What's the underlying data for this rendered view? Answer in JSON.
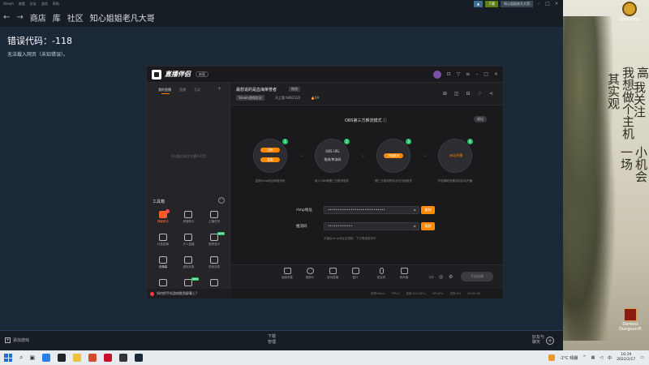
{
  "steam": {
    "titlebar_items": [
      "Steam",
      "查看",
      "好友",
      "游戏",
      "帮助"
    ],
    "top_btn": "",
    "green_btn": "下载",
    "user": "知心姐姐老凡大哥",
    "nav": [
      "商店",
      "库",
      "社区",
      "知心姐姐老凡大哥"
    ],
    "error_code": "错误代码：-118",
    "error_msg": "无法载入网页（未知错误）。",
    "add_game": "添加游戏",
    "downloads_title": "下载",
    "downloads_sub": "管理",
    "friends_l1": "好友与",
    "friends_l2": "聊天"
  },
  "desktop": {
    "icon1": "Cemonkyo",
    "icon2": "Darkest Dungeon®",
    "poem_cols": [
      "高",
      "我想做个主机",
      "其实观",
      "我关注",
      "一场",
      "小机会"
    ]
  },
  "app": {
    "name": "直播伴侣",
    "version": "新版",
    "left_tabs": [
      "我的直播",
      "直播",
      "互动"
    ],
    "empty_text": "0扫描后关注主播不可用",
    "tools_title": "工具箱",
    "tools": [
      {
        "label": "弹幕助手",
        "style": "red",
        "badge": "dot"
      },
      {
        "label": "房管助手",
        "style": "",
        "badge": ""
      },
      {
        "label": "主播任务",
        "style": "",
        "badge": ""
      },
      {
        "label": "抖音直播",
        "style": "",
        "badge": ""
      },
      {
        "label": "开人直播",
        "style": "",
        "badge": ""
      },
      {
        "label": "推荐音乐",
        "style": "",
        "badge": "new"
      },
      {
        "label": "设弹幕",
        "style": "bright",
        "badge": ""
      },
      {
        "label": "虚拟形象",
        "style": "",
        "badge": ""
      },
      {
        "label": "语音连麦",
        "style": "",
        "badge": ""
      },
      {
        "label": "",
        "style": "",
        "badge": ""
      },
      {
        "label": "",
        "style": "",
        "badge": "new"
      },
      {
        "label": "",
        "style": "",
        "badge": ""
      }
    ],
    "bottom_tip": "如何把手机游戏推到屏幕上?",
    "room_title": "最想说的是血海荣誉者",
    "room_edit": "修改",
    "room_tag": "Steam游戏实况",
    "room_id": "凡之我  9462120",
    "room_fire": "69",
    "mode_title": "OBS第三方推流模式",
    "exit": "退出",
    "steps": [
      {
        "num": "1",
        "pill1": "扫码",
        "pill2": "复制",
        "desc": "复制rtmp地址和推流码"
      },
      {
        "num": "2",
        "t1": "OBS URL",
        "t2": "推流/串流码",
        "desc": "填入OBS等第三方推流软件"
      },
      {
        "num": "3",
        "t1": "开始推流",
        "desc": "第三方推流软件点击开始推流"
      },
      {
        "num": "4",
        "t1": "启动开播",
        "desc": "伴侣确收到推流后启动开播"
      }
    ],
    "rtmp_label": "rtmp地址",
    "rtmp_value": "••••••••••••••••••••••••••••••",
    "key_label": "推流码",
    "key_value": "•••••••••••••",
    "copy": "复制",
    "field_tip": "关播后rtmp地址会更新，下次需重新填写",
    "toolbar": [
      "画面采集",
      "摄像头",
      "游戏直播",
      "窗口",
      "麦克风",
      "扬声器"
    ],
    "start_btn": "开始直播",
    "status": [
      "码率:0kb/s",
      "FPS:0",
      "丢帧:0(0.00%)",
      "CPU:0%",
      "内存:0%",
      "00:00:00"
    ]
  },
  "taskbar": {
    "weather": "-1°C 晴朗",
    "time": "16:29",
    "date": "2022/2/17"
  }
}
